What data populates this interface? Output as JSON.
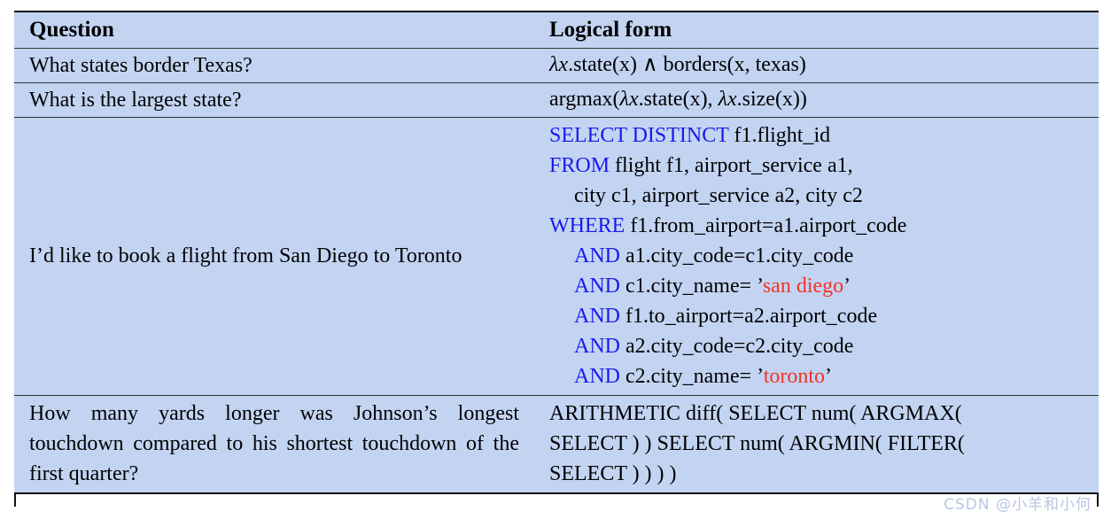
{
  "table": {
    "headers": {
      "question": "Question",
      "logical_form": "Logical form"
    },
    "rows": [
      {
        "question": "What states border Texas?",
        "logical_form_plain": "λx.state(x) ∧ borders(x, texas)",
        "lf_parts": {
          "lambda": "λ",
          "var": "x",
          "rest": ".state(x) ∧ borders(x, texas)"
        }
      },
      {
        "question": "What is the largest state?",
        "logical_form_plain": "argmax(λx.state(x), λx.size(x))",
        "lf_parts": {
          "head": "argmax(",
          "lambda1": "λ",
          "var1": "x",
          "mid": ".state(x), ",
          "lambda2": "λ",
          "var2": "x",
          "tail": ".size(x))"
        }
      },
      {
        "question": "I’d like to book a flight from San Diego to Toronto",
        "logical_form_type": "sql",
        "sql_lines": [
          {
            "indent": 0,
            "segments": [
              {
                "text": "SELECT DISTINCT",
                "kind": "keyword"
              },
              {
                "text": " f1.flight_id",
                "kind": "plain"
              }
            ]
          },
          {
            "indent": 0,
            "segments": [
              {
                "text": "FROM",
                "kind": "keyword"
              },
              {
                "text": " flight f1, airport_service a1,",
                "kind": "plain"
              }
            ]
          },
          {
            "indent": 1,
            "segments": [
              {
                "text": "city c1, airport_service a2, city c2",
                "kind": "plain"
              }
            ]
          },
          {
            "indent": 0,
            "segments": [
              {
                "text": "WHERE",
                "kind": "keyword"
              },
              {
                "text": " f1.from_airport=a1.airport_code",
                "kind": "plain"
              }
            ]
          },
          {
            "indent": 1,
            "segments": [
              {
                "text": "AND",
                "kind": "keyword"
              },
              {
                "text": " a1.city_code=c1.city_code",
                "kind": "plain"
              }
            ]
          },
          {
            "indent": 1,
            "segments": [
              {
                "text": "AND",
                "kind": "keyword"
              },
              {
                "text": " c1.city_name= ’",
                "kind": "plain"
              },
              {
                "text": "san diego",
                "kind": "string"
              },
              {
                "text": "’",
                "kind": "plain"
              }
            ]
          },
          {
            "indent": 1,
            "segments": [
              {
                "text": "AND",
                "kind": "keyword"
              },
              {
                "text": " f1.to_airport=a2.airport_code",
                "kind": "plain"
              }
            ]
          },
          {
            "indent": 1,
            "segments": [
              {
                "text": "AND",
                "kind": "keyword"
              },
              {
                "text": " a2.city_code=c2.city_code",
                "kind": "plain"
              }
            ]
          },
          {
            "indent": 1,
            "segments": [
              {
                "text": "AND",
                "kind": "keyword"
              },
              {
                "text": " c2.city_name= ’",
                "kind": "plain"
              },
              {
                "text": "toronto",
                "kind": "string"
              },
              {
                "text": "’",
                "kind": "plain"
              }
            ]
          }
        ]
      },
      {
        "question": "How many yards longer was Johnson’s longest touchdown compared to his shortest touchdown of the first quarter?",
        "logical_form_type": "arithmetic",
        "arith_lines": [
          "ARITHMETIC diff( SELECT num( ARGMAX(",
          "SELECT ) ) SELECT num( ARGMIN( FILTER(",
          "SELECT ) ) ) )"
        ]
      }
    ]
  },
  "watermark": {
    "text": "CSDN @小羊和小何"
  },
  "colors": {
    "cell_background": "#c3d4f2",
    "keyword": "#1a1aee",
    "string_literal": "#f33226",
    "text": "#000000",
    "rule": "#111111",
    "watermark": "#b9c6e2"
  }
}
